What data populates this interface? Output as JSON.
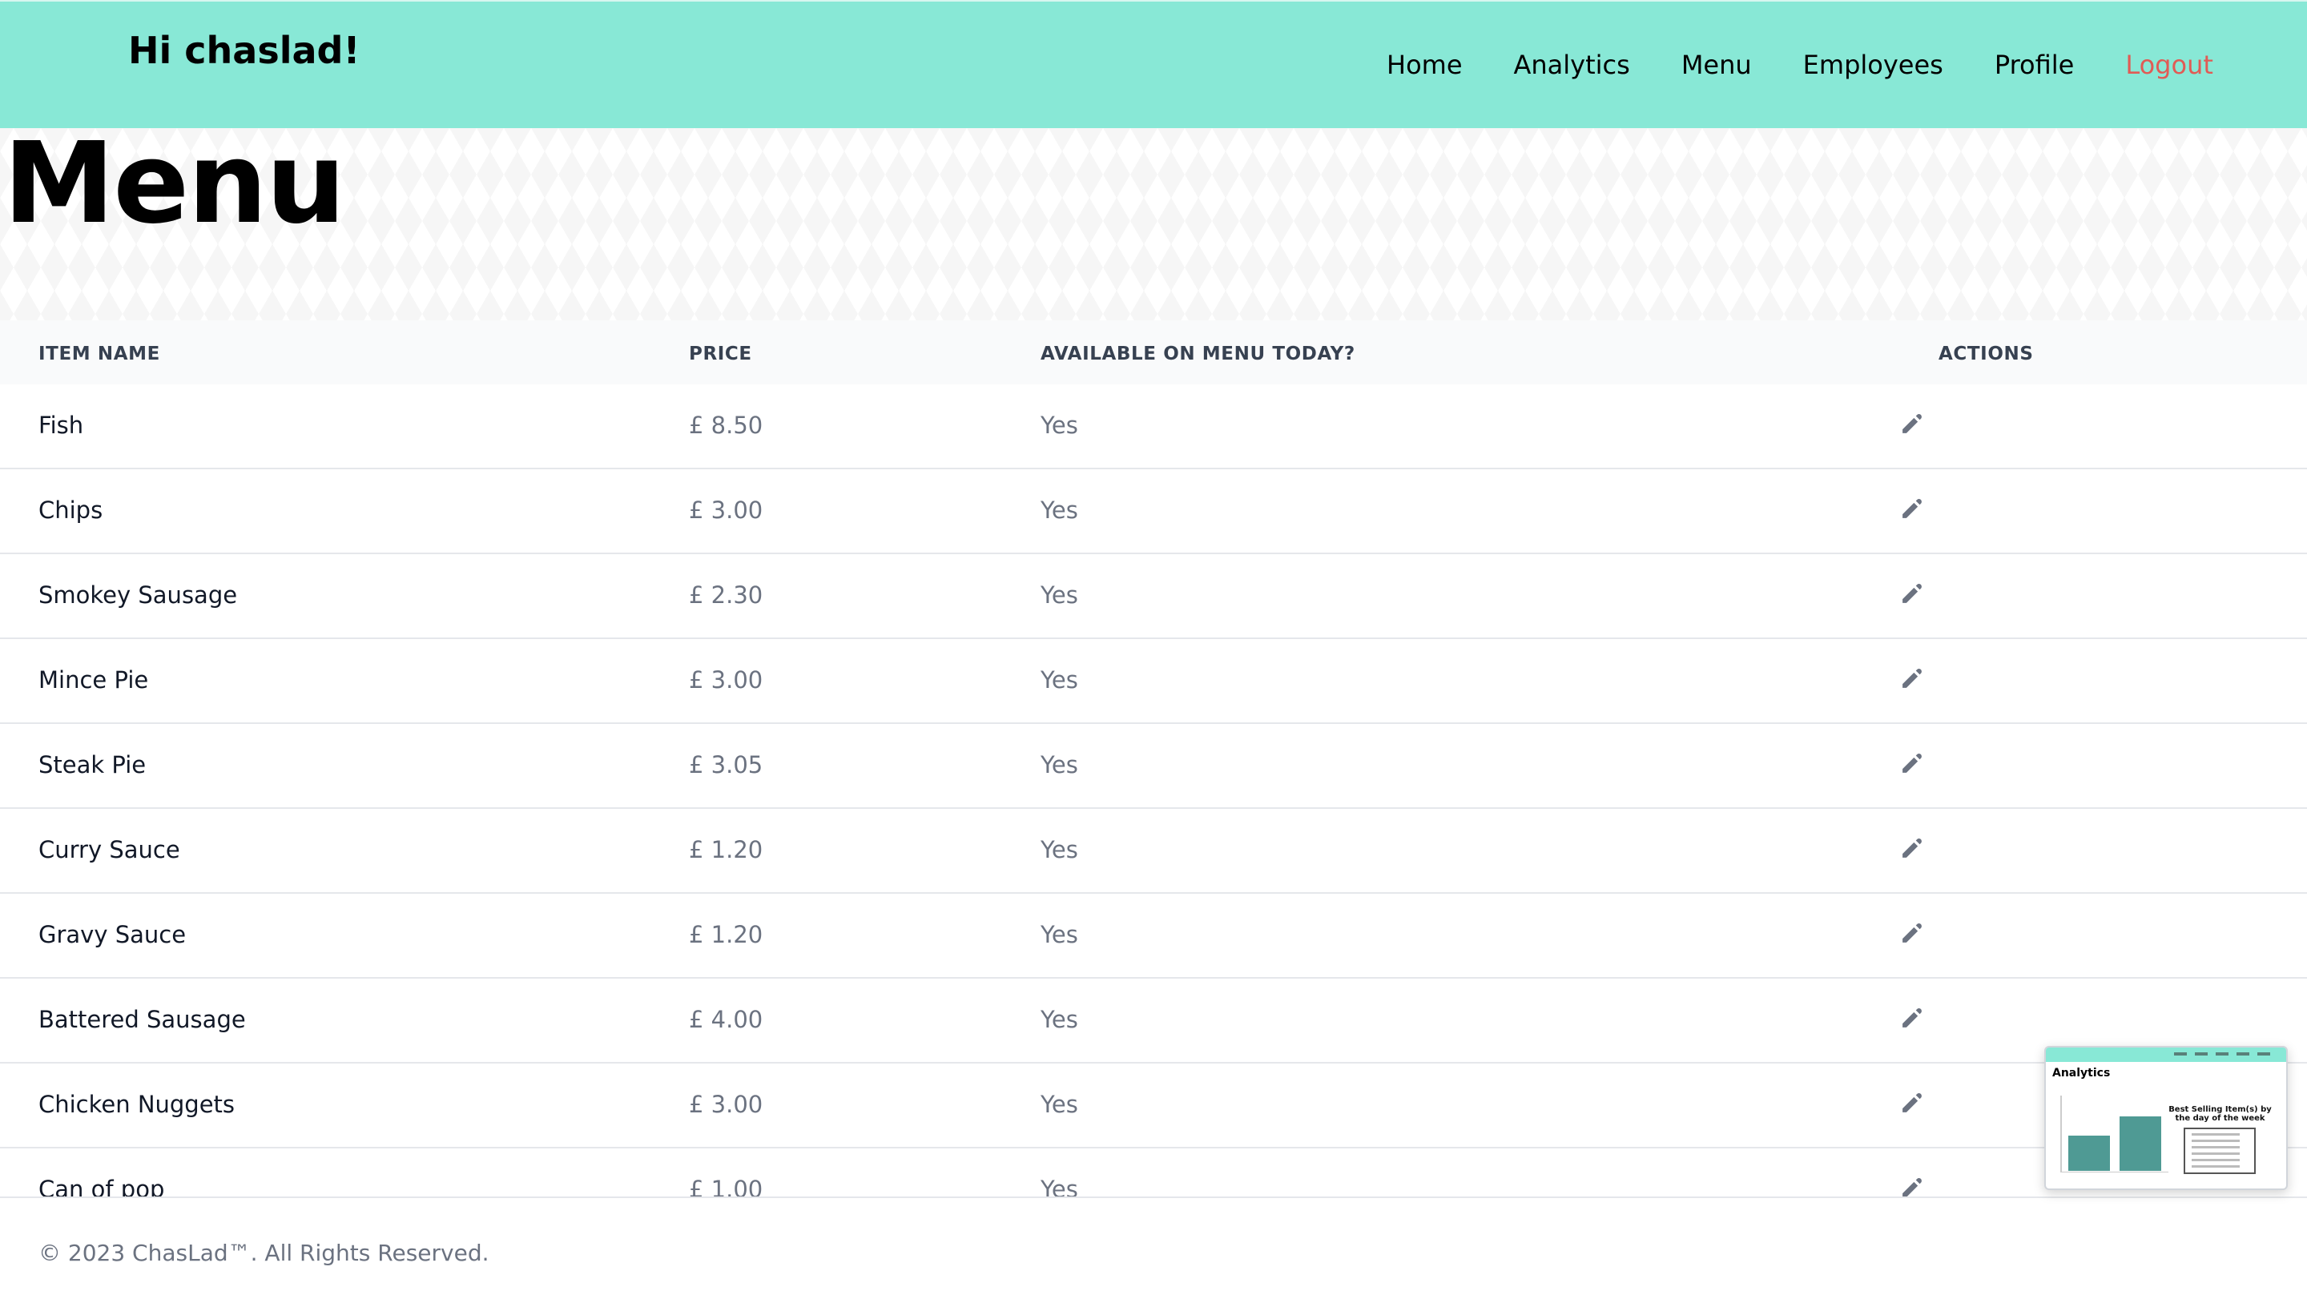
{
  "header": {
    "greeting": "Hi chaslad!",
    "nav": [
      {
        "label": "Home"
      },
      {
        "label": "Analytics"
      },
      {
        "label": "Menu"
      },
      {
        "label": "Employees"
      },
      {
        "label": "Profile"
      },
      {
        "label": "Logout"
      }
    ],
    "logout_color": "#e15b55",
    "navbar_color": "#88e8d6"
  },
  "page": {
    "title": "Menu"
  },
  "table": {
    "columns": [
      "ITEM NAME",
      "PRICE",
      "AVAILABLE ON MENU TODAY?",
      "ACTIONS"
    ],
    "rows": [
      {
        "name": "Fish",
        "price": "£ 8.50",
        "available": "Yes"
      },
      {
        "name": "Chips",
        "price": "£ 3.00",
        "available": "Yes"
      },
      {
        "name": "Smokey Sausage",
        "price": "£ 2.30",
        "available": "Yes"
      },
      {
        "name": "Mince Pie",
        "price": "£ 3.00",
        "available": "Yes"
      },
      {
        "name": "Steak Pie",
        "price": "£ 3.05",
        "available": "Yes"
      },
      {
        "name": "Curry Sauce",
        "price": "£ 1.20",
        "available": "Yes"
      },
      {
        "name": "Gravy Sauce",
        "price": "£ 1.20",
        "available": "Yes"
      },
      {
        "name": "Battered Sausage",
        "price": "£ 4.00",
        "available": "Yes"
      },
      {
        "name": "Chicken Nuggets",
        "price": "£ 3.00",
        "available": "Yes"
      },
      {
        "name": "Can of pop",
        "price": "£ 1.00",
        "available": "Yes"
      }
    ],
    "action_icon": "pencil-icon"
  },
  "footer": {
    "copyright": "© 2023 ChasLad™. All Rights Reserved."
  },
  "preview": {
    "title": "Analytics",
    "chart_title": "Best Selling Item(s) by the day of the week"
  }
}
